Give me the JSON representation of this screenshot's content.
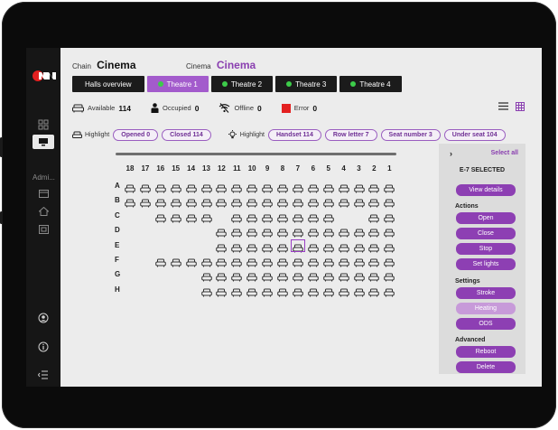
{
  "header": {
    "chain_label": "Chain",
    "chain_value": "Cinema",
    "cinema_label": "Cinema",
    "cinema_value": "Cinema"
  },
  "tabs": [
    {
      "label": "Halls overview",
      "dot": false,
      "active": false
    },
    {
      "label": "Theatre 1",
      "dot": true,
      "active": true
    },
    {
      "label": "Theatre 2",
      "dot": true,
      "active": false
    },
    {
      "label": "Theatre 3",
      "dot": true,
      "active": false
    },
    {
      "label": "Theatre 4",
      "dot": true,
      "active": false
    }
  ],
  "status": {
    "available_label": "Available",
    "available_value": "114",
    "occupied_label": "Occupied",
    "occupied_value": "0",
    "offline_label": "Offline",
    "offline_value": "0",
    "error_label": "Error",
    "error_value": "0",
    "error_color": "#e32020"
  },
  "highlight": {
    "label1": "Highlight",
    "chips1": [
      "Opened 0",
      "Closed 114"
    ],
    "label2": "Highlight",
    "chips2": [
      "Handset 114",
      "Row letter 7",
      "Seat number 3",
      "Under seat 104"
    ]
  },
  "rail": {
    "admin_label": "Admi..."
  },
  "seat_map": {
    "columns": [
      "18",
      "17",
      "16",
      "15",
      "14",
      "13",
      "12",
      "11",
      "10",
      "9",
      "8",
      "7",
      "6",
      "5",
      "4",
      "3",
      "2",
      "1"
    ],
    "rows": [
      {
        "label": "A",
        "seats": "111111111111111111"
      },
      {
        "label": "B",
        "seats": "111111111111111111"
      },
      {
        "label": "C",
        "seats": "001111011111110011"
      },
      {
        "label": "D",
        "seats": "000000111111111111"
      },
      {
        "label": "E",
        "seats": "000000111111111111"
      },
      {
        "label": "F",
        "seats": "001111111111111111"
      },
      {
        "label": "G",
        "seats": "000001111111111111"
      },
      {
        "label": "H",
        "seats": "000001111111111111"
      }
    ],
    "selected_seat": "E-7",
    "accent": "#9a3fc4"
  },
  "panel": {
    "collapse_glyph": "›",
    "select_all": "Select all",
    "selected_text": "E-7 SELECTED",
    "view_details": "View details",
    "actions_title": "Actions",
    "actions": [
      "Open",
      "Close",
      "Stop",
      "Set lights"
    ],
    "settings_title": "Settings",
    "settings": [
      "Stroke",
      "Heating",
      "ODS"
    ],
    "advanced_title": "Advanced",
    "advanced": [
      "Reboot",
      "Delete"
    ],
    "accent": "#8d3fb3"
  }
}
